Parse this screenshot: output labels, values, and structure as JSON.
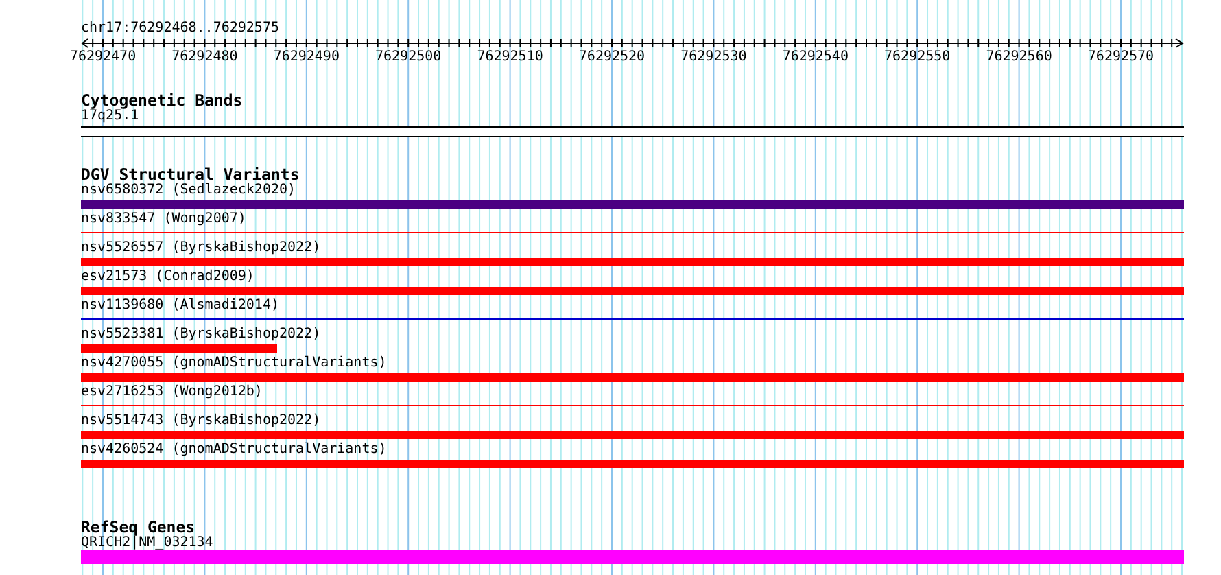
{
  "location": "chr17:76292468..76292575",
  "ruler": {
    "labels": [
      "76292470",
      "76292480",
      "76292490",
      "76292500",
      "76292510",
      "76292520",
      "76292530",
      "76292540",
      "76292550",
      "76292560",
      "76292570"
    ]
  },
  "tracks": [
    {
      "title": "Cytogenetic Bands",
      "kind": "bands",
      "features": [
        {
          "name": "17q25.1",
          "kind": "band",
          "color": "#ffffff"
        }
      ]
    },
    {
      "title": "DGV Structural Variants",
      "kind": "features",
      "features": [
        {
          "name": "nsv6580372 (Sedlazeck2020)",
          "kind": "thick",
          "color": "#4b0082"
        },
        {
          "name": "nsv833547 (Wong2007)",
          "kind": "thin",
          "color": "#ff0000"
        },
        {
          "name": "nsv5526557 (ByrskaBishop2022)",
          "kind": "thick",
          "color": "#ff0000"
        },
        {
          "name": "esv21573 (Conrad2009)",
          "kind": "thick",
          "color": "#ff0000"
        },
        {
          "name": "nsv1139680 (Alsmadi2014)",
          "kind": "thin",
          "color": "#0000cd"
        },
        {
          "name": "nsv5523381 (ByrskaBishop2022)",
          "kind": "thick",
          "color": "#ff0000",
          "level": 0.178
        },
        {
          "name": "nsv4270055 (gnomADStructuralVariants)",
          "kind": "thick",
          "color": "#ff0000"
        },
        {
          "name": "esv2716253 (Wong2012b)",
          "kind": "thin",
          "color": "#ff0000"
        },
        {
          "name": "nsv5514743 (ByrskaBishop2022)",
          "kind": "thick",
          "color": "#ff0000"
        },
        {
          "name": "nsv4260524 (gnomADStructuralVariants)",
          "kind": "thick",
          "color": "#ff0000"
        }
      ]
    },
    {
      "title": "RefSeq Genes",
      "kind": "genes",
      "features": [
        {
          "name": "QRICH2|NM_032134",
          "kind": "gene",
          "color": "#ff00ff"
        }
      ]
    }
  ]
}
